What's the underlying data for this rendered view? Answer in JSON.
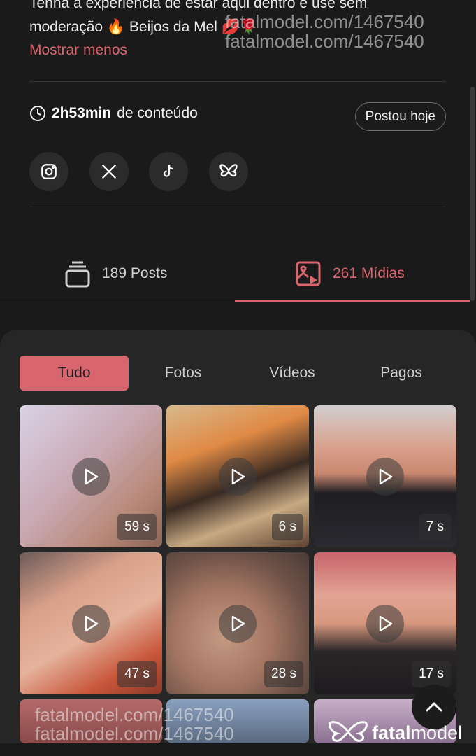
{
  "bio": {
    "line1": "Tenha a experiência de estar aqui dentro e use sem",
    "line2": "moderação 🔥 Beijos da Mel 💋🌹",
    "show_less": "Mostrar menos"
  },
  "content_info": {
    "duration": "2h53min",
    "suffix": "de conteúdo",
    "posted_badge": "Postou hoje"
  },
  "social": [
    {
      "name": "instagram-icon"
    },
    {
      "name": "x-icon"
    },
    {
      "name": "tiktok-icon"
    },
    {
      "name": "bluesky-icon"
    }
  ],
  "tabs": {
    "posts": "189 Posts",
    "media": "261 Mídias",
    "active": "media"
  },
  "filters": [
    "Tudo",
    "Fotos",
    "Vídeos",
    "Pagos"
  ],
  "active_filter": "Tudo",
  "media_items": [
    {
      "duration": "59 s"
    },
    {
      "duration": "6 s"
    },
    {
      "duration": "7 s"
    },
    {
      "duration": "47 s"
    },
    {
      "duration": "28 s"
    },
    {
      "duration": "17 s"
    }
  ],
  "watermark": "fatalmodel.com/1467540",
  "brand": {
    "prefix": "fatal",
    "suffix": "model"
  },
  "colors": {
    "accent": "#d9656f",
    "background": "#1a1a1a",
    "panel": "#262626"
  }
}
